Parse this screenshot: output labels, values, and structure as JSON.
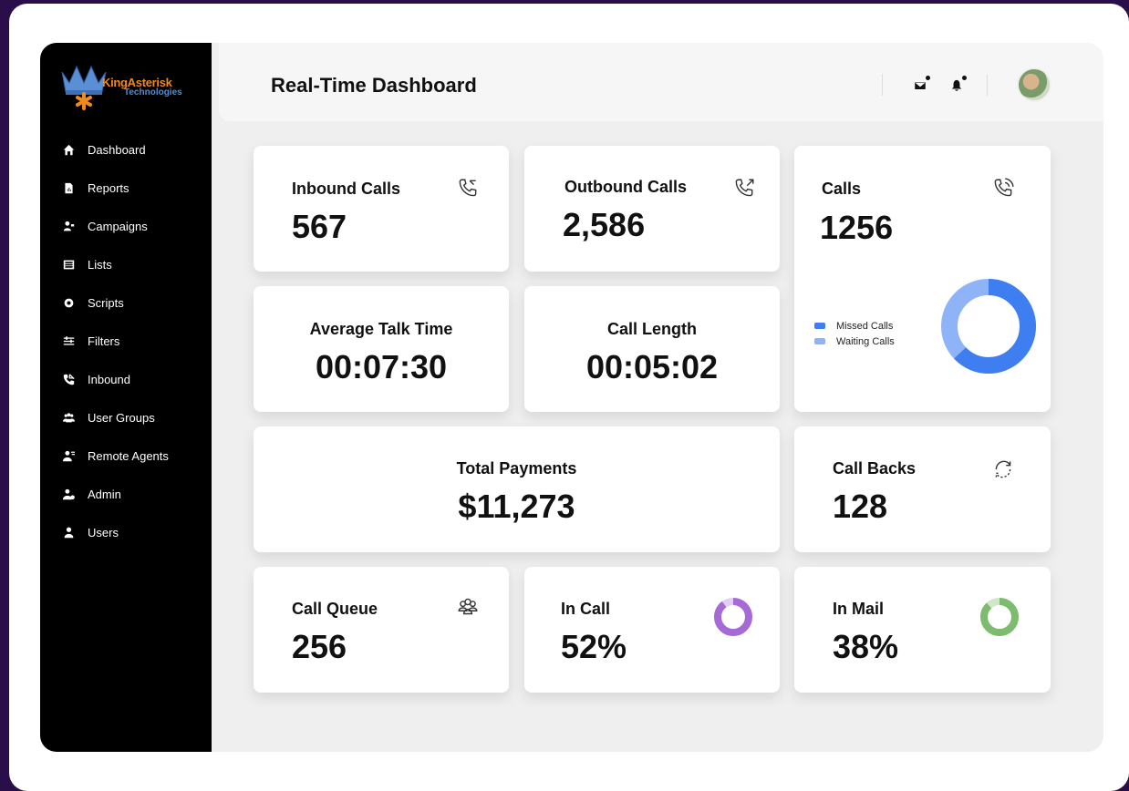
{
  "brand": {
    "line1": "KingAsterisk",
    "line2": "Technologies"
  },
  "sidebar": {
    "items": [
      {
        "label": "Dashboard",
        "icon": "home-icon"
      },
      {
        "label": "Reports",
        "icon": "report-icon"
      },
      {
        "label": "Campaigns",
        "icon": "campaign-icon"
      },
      {
        "label": "Lists",
        "icon": "list-icon"
      },
      {
        "label": "Scripts",
        "icon": "script-icon"
      },
      {
        "label": "Filters",
        "icon": "filter-icon"
      },
      {
        "label": "Inbound",
        "icon": "inbound-icon"
      },
      {
        "label": "User Groups",
        "icon": "user-groups-icon"
      },
      {
        "label": "Remote Agents",
        "icon": "remote-agents-icon"
      },
      {
        "label": "Admin",
        "icon": "admin-icon"
      },
      {
        "label": "Users",
        "icon": "users-icon"
      }
    ]
  },
  "header": {
    "title": "Real-Time Dashboard"
  },
  "cards": {
    "inbound": {
      "label": "Inbound Calls",
      "value": "567",
      "icon": "phone-incoming-icon"
    },
    "outbound": {
      "label": "Outbound Calls",
      "value": "2,586",
      "icon": "phone-outgoing-icon"
    },
    "calls": {
      "label": "Calls",
      "value": "1256",
      "icon": "phone-ringing-icon"
    },
    "avg_talk": {
      "label": "Average Talk Time",
      "value": "00:07:30"
    },
    "call_length": {
      "label": "Call Length",
      "value": "00:05:02"
    },
    "payments": {
      "label": "Total Payments",
      "value": "$11,273"
    },
    "callbacks": {
      "label": "Call Backs",
      "value": "128",
      "icon": "refresh-icon"
    },
    "queue": {
      "label": "Call Queue",
      "value": "256",
      "icon": "people-icon"
    },
    "in_call": {
      "label": "In Call",
      "value": "52%",
      "fraction": 0.52
    },
    "in_mail": {
      "label": "In Mail",
      "value": "38%",
      "fraction": 0.38
    }
  },
  "calls_legend": [
    {
      "label": "Missed Calls",
      "color": "#3e7ef0"
    },
    {
      "label": "Waiting Calls",
      "color": "#8fb3f7"
    }
  ],
  "colors": {
    "in_call": "#a56ad6",
    "in_call_track": "#e3cff4",
    "in_mail": "#7dbb6e",
    "in_mail_track": "#cfe7c7"
  }
}
